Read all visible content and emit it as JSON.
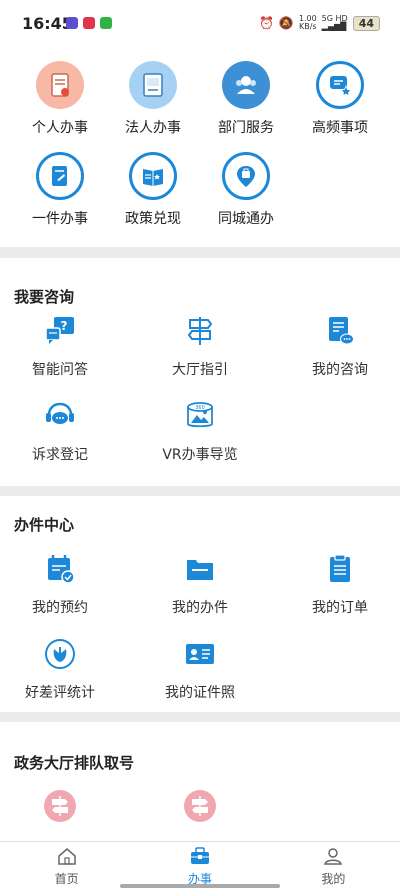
{
  "status_bar": {
    "time": "16:45",
    "network_speed_value": "1.00",
    "network_speed_unit": "KB/s",
    "signal_label": "5G HD",
    "battery": "44"
  },
  "top_services": [
    {
      "label": "个人办事",
      "icon": "personal-affairs-icon"
    },
    {
      "label": "法人办事",
      "icon": "legal-person-icon"
    },
    {
      "label": "部门服务",
      "icon": "department-service-icon"
    },
    {
      "label": "高频事项",
      "icon": "high-frequency-icon"
    },
    {
      "label": "一件办事",
      "icon": "one-stop-icon"
    },
    {
      "label": "政策兑现",
      "icon": "policy-icon"
    },
    {
      "label": "同城通办",
      "icon": "same-city-icon"
    }
  ],
  "consult": {
    "title": "我要咨询",
    "items": [
      {
        "label": "智能问答",
        "icon": "smart-qa-icon"
      },
      {
        "label": "大厅指引",
        "icon": "hall-guide-icon"
      },
      {
        "label": "我的咨询",
        "icon": "my-consult-icon"
      },
      {
        "label": "诉求登记",
        "icon": "appeal-register-icon"
      },
      {
        "label": "VR办事导览",
        "icon": "vr-guide-icon"
      }
    ]
  },
  "center": {
    "title": "办件中心",
    "items": [
      {
        "label": "我的预约",
        "icon": "appointment-icon"
      },
      {
        "label": "我的办件",
        "icon": "my-case-icon"
      },
      {
        "label": "我的订单",
        "icon": "my-order-icon"
      },
      {
        "label": "好差评统计",
        "icon": "rating-stats-icon"
      },
      {
        "label": "我的证件照",
        "icon": "id-photo-icon"
      }
    ]
  },
  "queue": {
    "title": "政务大厅排队取号",
    "items": [
      {
        "label": "",
        "icon": "queue-ticket-icon"
      },
      {
        "label": "",
        "icon": "queue-ticket-icon"
      }
    ]
  },
  "bottom_nav": [
    {
      "label": "首页",
      "icon": "home-icon"
    },
    {
      "label": "办事",
      "icon": "briefcase-icon"
    },
    {
      "label": "我的",
      "icon": "user-icon"
    }
  ],
  "colors": {
    "accent": "#1e88d8",
    "salmon": "#f7b8a5",
    "light_blue": "#a7d1f2",
    "queue_pink": "#f1a7b0",
    "divider": "#ececec"
  }
}
